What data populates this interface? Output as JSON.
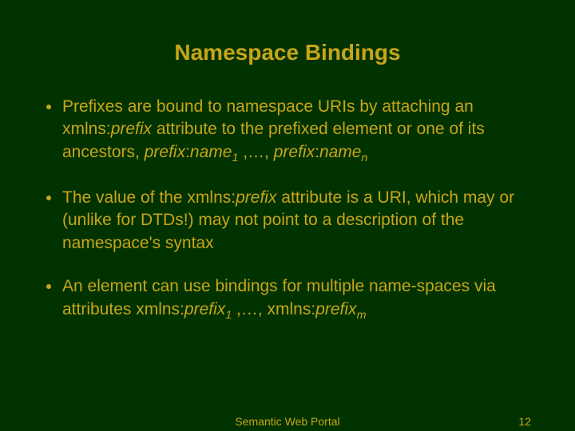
{
  "title": "Namespace Bindings",
  "bullets": {
    "b1": {
      "t1": "Prefixes are bound to namespace URIs by attaching an xmlns:",
      "i1": "prefix",
      "t2": " attribute to the prefixed element or one of its ancestors, ",
      "i2": "prefix",
      "t3": ":",
      "i3": "name",
      "s1": "1",
      "t4": " ,…, ",
      "i4": "prefix",
      "t5": ":",
      "i5": "name",
      "s2": "n"
    },
    "b2": {
      "t1": "The value of the xmlns:",
      "i1": "prefix",
      "t2": " attribute is a URI, which may or (unlike for DTDs!) may not point to a description of the namespace's syntax"
    },
    "b3": {
      "t1": "An element can use bindings for multiple name-spaces via attributes xmlns:",
      "i1": "prefix",
      "s1": "1",
      "t2": " ,…, xmlns:",
      "i2": "prefix",
      "s2": "m"
    }
  },
  "footer": {
    "center": "Semantic Web Portal",
    "page": "12"
  }
}
